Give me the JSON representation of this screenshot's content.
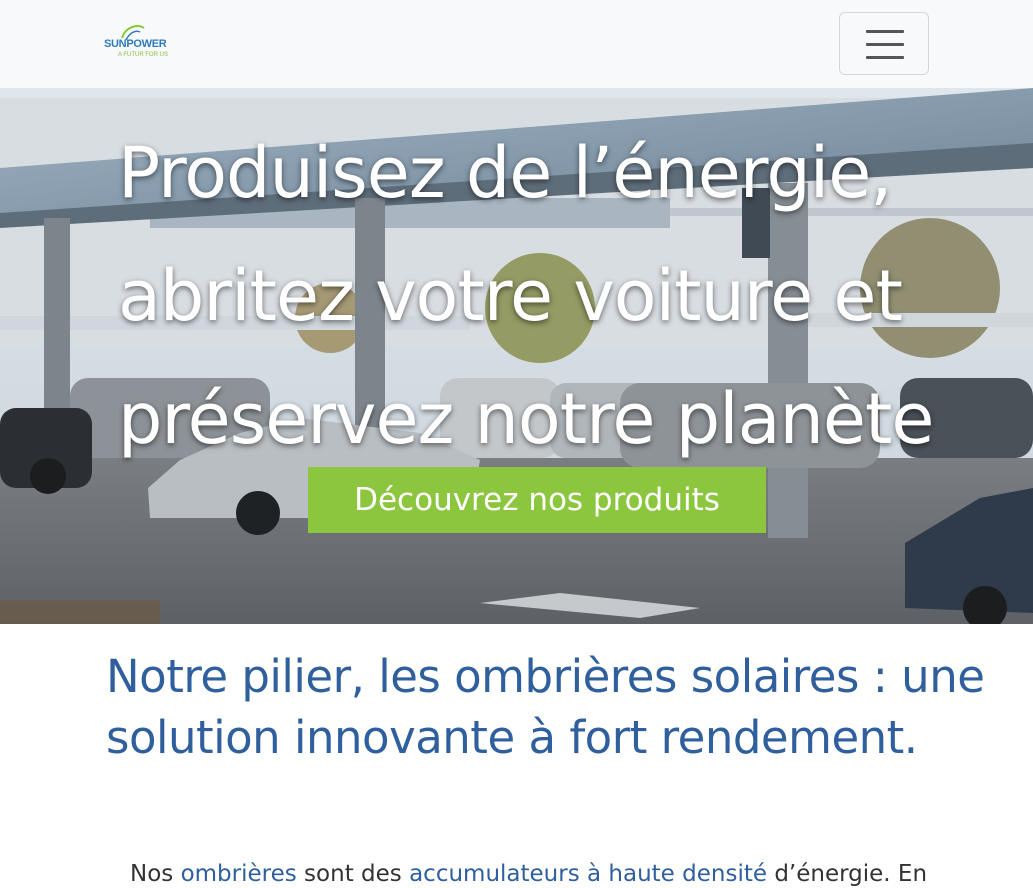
{
  "colors": {
    "navbar_bg": "#f8f9fa",
    "brand_blue": "#2f5f9d",
    "brand_green": "#8cc63f",
    "hero_text": "#ffffff",
    "body_text": "#333333"
  },
  "navbar": {
    "logo_name": "SUNPOWER",
    "logo_tagline": "A FUTUR FOR US",
    "menu_icon": "hamburger-menu-icon"
  },
  "hero": {
    "title_line1": "Produisez de l’énergie,",
    "title_line2": "abritez votre voiture et",
    "title_line3": "préservez notre planète",
    "cta_label": "Découvrez nos produits"
  },
  "section": {
    "title": "Notre pilier, les ombrières solaires : une solution innovante à fort rendement.",
    "intro": {
      "t1": "Nos ",
      "link1": "ombrières",
      "t2": " sont des ",
      "link2": "accumulateurs à haute densité",
      "t3": " d’énergie. En"
    }
  }
}
